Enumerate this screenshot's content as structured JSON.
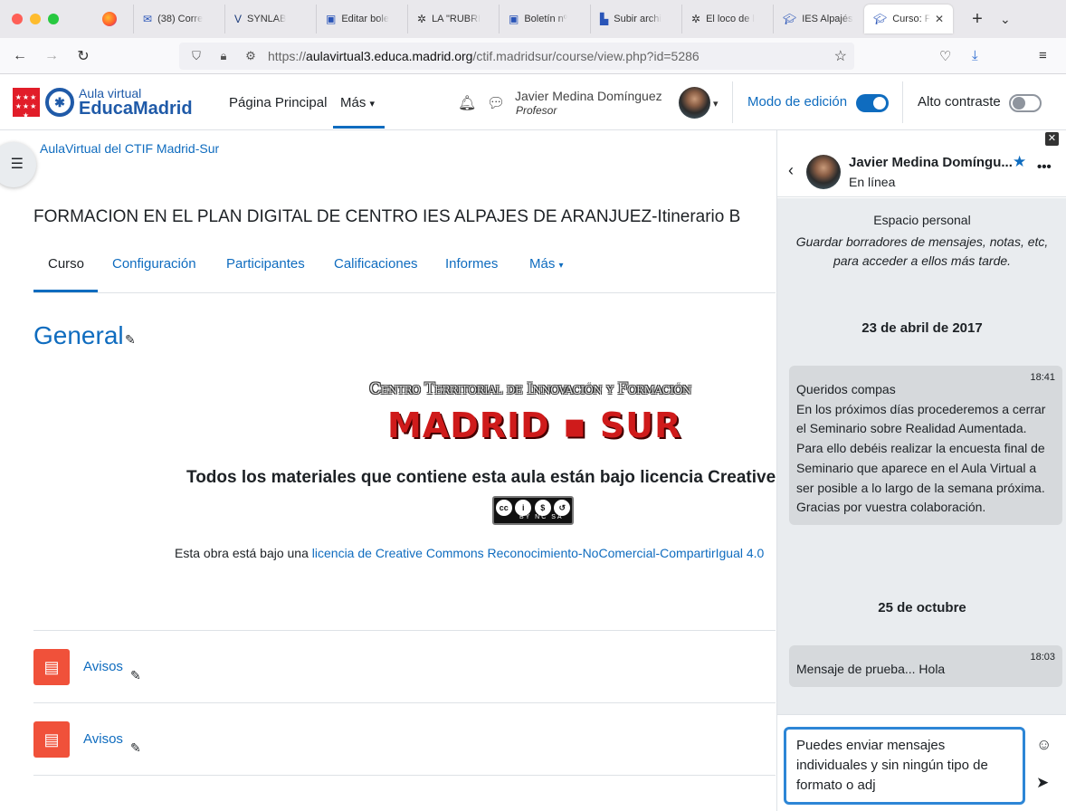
{
  "browser": {
    "tabs": [
      {
        "label": "(38) Corre",
        "icon": "mail-icon"
      },
      {
        "label": "SYNLAB",
        "icon": "synlab-icon"
      },
      {
        "label": "Editar bole",
        "icon": "news-icon"
      },
      {
        "label": "LA \"RUBRI",
        "icon": "gear-icon"
      },
      {
        "label": "Boletín nº",
        "icon": "news-icon"
      },
      {
        "label": "Subir archi",
        "icon": "clapper-icon"
      },
      {
        "label": "El loco de l",
        "icon": "gear-icon"
      },
      {
        "label": "IES Alpajés",
        "icon": "mortarboard-icon"
      }
    ],
    "active_tab": {
      "label": "Curso: F",
      "icon": "mortarboard-icon"
    },
    "url": "https://aulavirtual3.educa.madrid.org/ctif.madridsur/course/view.php?id=5286",
    "url_domain": "aulavirtual3.educa.madrid.org",
    "url_prefix": "https://",
    "url_suffix": "/ctif.madridsur/course/view.php?id=5286"
  },
  "header": {
    "logo_line1": "Aula virtual",
    "logo_line2": "EducaMadrid",
    "nav_home": "Página Principal",
    "nav_more": "Más",
    "user_name": "Javier Medina Domínguez",
    "user_role": "Profesor",
    "edit_mode_label": "Modo de edición",
    "edit_mode_on": true,
    "high_contrast_label": "Alto contraste",
    "high_contrast_on": false,
    "accent_color": "#0f6cbf"
  },
  "course": {
    "breadcrumb": "AulaVirtual del CTIF Madrid-Sur",
    "title": "FORMACION EN EL PLAN DIGITAL DE CENTRO IES ALPAJES DE ARANJUEZ-Itinerario B",
    "tabs": [
      "Curso",
      "Configuración",
      "Participantes",
      "Calificaciones",
      "Informes",
      "Más"
    ],
    "active_tab": "Curso",
    "section_title": "General",
    "banner_line1": "Centro Territorial de Innovación y Formación",
    "banner_line2": "MADRID ▪ SUR",
    "licence_heading": "Todos los materiales que contiene esta aula están bajo licencia Creative Commons",
    "cc_badge_text": "BY  NC  SA",
    "obra_text": "Esta obra está bajo una ",
    "obra_link": "licencia de Creative Commons Reconocimiento-NoComercial-CompartirIgual 4.0",
    "activities": [
      {
        "name": "Avisos"
      },
      {
        "name": "Avisos"
      }
    ]
  },
  "messaging": {
    "contact_name": "Javier Medina Domíngu...",
    "status": "En línea",
    "personal_space_title": "Espacio personal",
    "personal_space_desc": "Guardar borradores de mensajes, notas, etc, para acceder a ellos más tarde.",
    "conversations": [
      {
        "date": "23 de abril de 2017",
        "time": "18:41",
        "lines": [
          "Queridos compas",
          "En los próximos días procederemos a cerrar el Seminario sobre Realidad Aumentada.",
          "Para ello debéis realizar la encuesta final de Seminario que aparece en el Aula Virtual a ser posible a lo largo de la semana próxima.",
          "Gracias por vuestra colaboración."
        ]
      },
      {
        "date": "25 de octubre",
        "time": "18:03",
        "lines": [
          "Mensaje de prueba... Hola"
        ]
      }
    ],
    "draft": "Puedes enviar mensajes individuales y sin ningún tipo de formato o adj"
  }
}
